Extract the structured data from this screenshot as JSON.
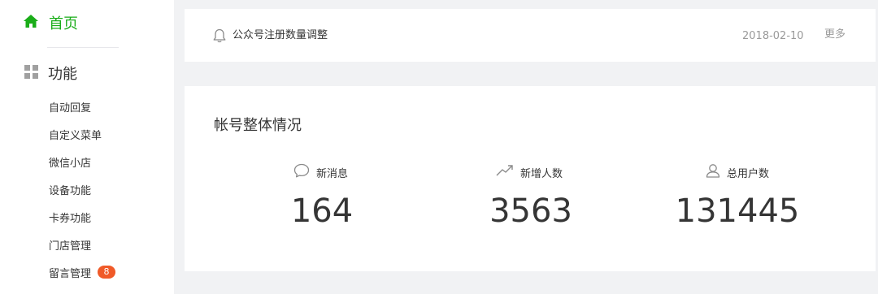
{
  "sidebar": {
    "home": {
      "label": "首页",
      "icon": "home-icon",
      "active_color": "#1aad19"
    },
    "function": {
      "label": "功能",
      "icon": "grid-icon"
    },
    "items": [
      {
        "label": "自动回复"
      },
      {
        "label": "自定义菜单"
      },
      {
        "label": "微信小店"
      },
      {
        "label": "设备功能"
      },
      {
        "label": "卡券功能"
      },
      {
        "label": "门店管理"
      },
      {
        "label": "留言管理",
        "badge": "8"
      }
    ]
  },
  "notice": {
    "icon": "bell-icon",
    "title": "公众号注册数量调整",
    "date": "2018-02-10",
    "more": "更多"
  },
  "overview": {
    "title": "帐号整体情况",
    "stats": [
      {
        "icon": "chat-bubble-icon",
        "label": "新消息",
        "value": "164"
      },
      {
        "icon": "trend-up-icon",
        "label": "新增人数",
        "value": "3563"
      },
      {
        "icon": "user-icon",
        "label": "总用户数",
        "value": "131445"
      }
    ]
  },
  "colors": {
    "accent": "#1aad19",
    "badge": "#f05a28",
    "background": "#f1f2f4"
  }
}
